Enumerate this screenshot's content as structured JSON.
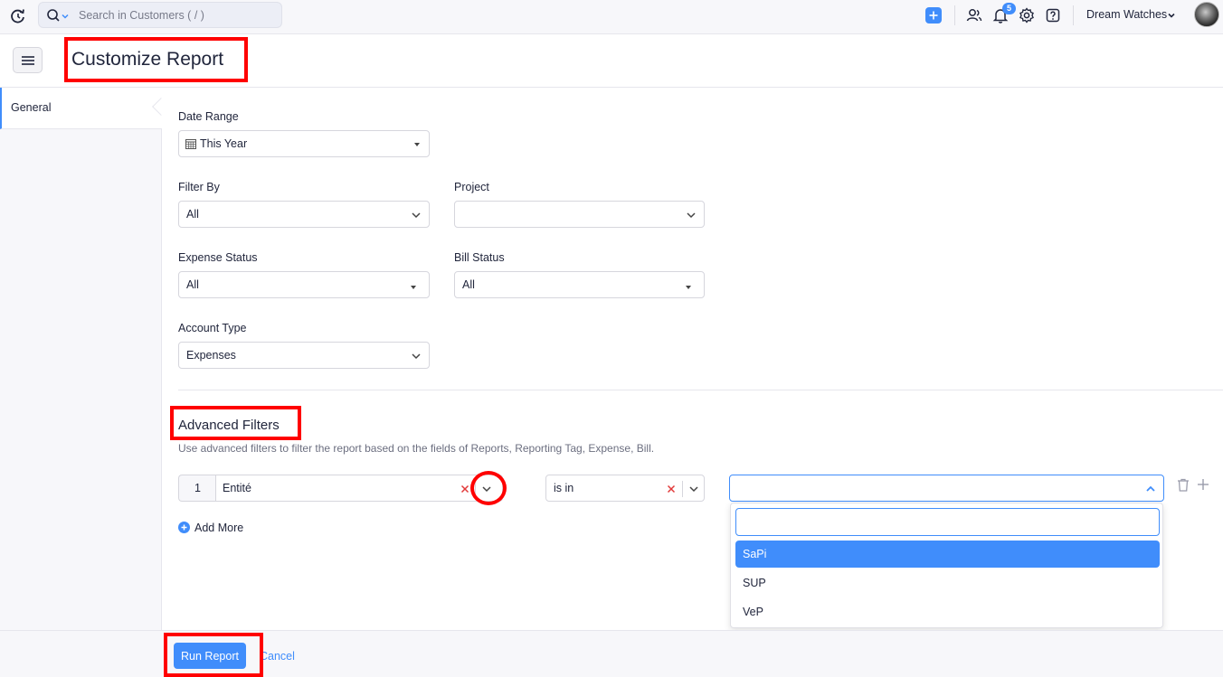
{
  "topbar": {
    "search_placeholder": "Search in Customers ( / )",
    "notification_count": "5",
    "org_name": "Dream Watches"
  },
  "header": {
    "title": "Customize Report"
  },
  "sidebar": {
    "items": [
      {
        "label": "General",
        "active": true
      }
    ]
  },
  "form": {
    "date_range": {
      "label": "Date Range",
      "value": "This Year"
    },
    "filter_by": {
      "label": "Filter By",
      "value": "All"
    },
    "project": {
      "label": "Project",
      "value": ""
    },
    "expense_status": {
      "label": "Expense Status",
      "value": "All"
    },
    "bill_status": {
      "label": "Bill Status",
      "value": "All"
    },
    "account_type": {
      "label": "Account Type",
      "value": "Expenses"
    }
  },
  "advanced": {
    "title": "Advanced Filters",
    "description": "Use advanced filters to filter the report based on the fields of Reports, Reporting Tag, Expense, Bill.",
    "rows": [
      {
        "number": "1",
        "field": "Entité",
        "operator": "is in",
        "value": ""
      }
    ],
    "add_more_label": "Add More",
    "dropdown_options": [
      {
        "label": "SaPi",
        "selected": true
      },
      {
        "label": "SUP",
        "selected": false
      },
      {
        "label": "VeP",
        "selected": false
      }
    ]
  },
  "footer": {
    "run_label": "Run Report",
    "cancel_label": "Cancel"
  },
  "colors": {
    "accent": "#408dfb",
    "highlight": "#ff0000"
  }
}
